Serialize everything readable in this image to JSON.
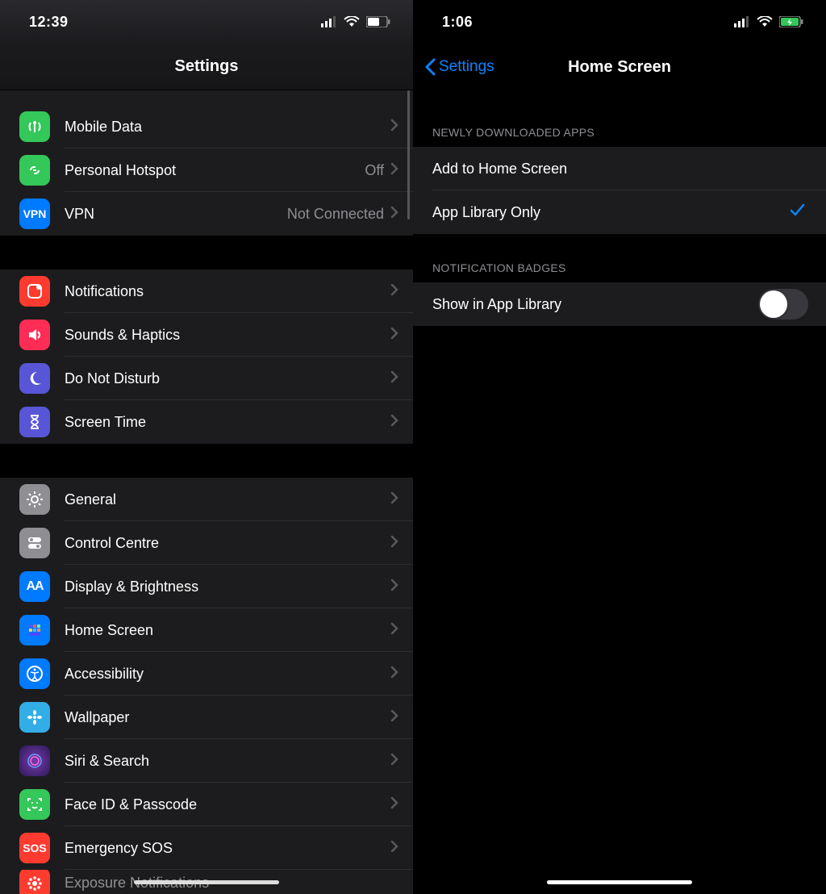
{
  "left": {
    "status_time": "12:39",
    "title": "Settings",
    "group1": [
      {
        "label": "Mobile Data",
        "icon": "cellular-antenna-icon",
        "bg": "bg-green"
      },
      {
        "label": "Personal Hotspot",
        "detail": "Off",
        "icon": "link-icon",
        "bg": "bg-green"
      },
      {
        "label": "VPN",
        "detail": "Not Connected",
        "icon": "vpn-icon",
        "bg": "bg-blue",
        "text_glyph": "VPN"
      }
    ],
    "group2": [
      {
        "label": "Notifications",
        "icon": "notification-icon",
        "bg": "bg-red"
      },
      {
        "label": "Sounds & Haptics",
        "icon": "speaker-icon",
        "bg": "bg-pink"
      },
      {
        "label": "Do Not Disturb",
        "icon": "moon-icon",
        "bg": "bg-purple"
      },
      {
        "label": "Screen Time",
        "icon": "hourglass-icon",
        "bg": "bg-purple"
      }
    ],
    "group3": [
      {
        "label": "General",
        "icon": "gear-icon",
        "bg": "bg-gray"
      },
      {
        "label": "Control Centre",
        "icon": "switches-icon",
        "bg": "bg-gray"
      },
      {
        "label": "Display & Brightness",
        "icon": "text-size-icon",
        "bg": "bg-blue",
        "text_glyph": "AA"
      },
      {
        "label": "Home Screen",
        "icon": "home-grid-icon",
        "bg": "bg-blue"
      },
      {
        "label": "Accessibility",
        "icon": "accessibility-icon",
        "bg": "bg-blue"
      },
      {
        "label": "Wallpaper",
        "icon": "flower-icon",
        "bg": "bg-cyan"
      },
      {
        "label": "Siri & Search",
        "icon": "siri-icon",
        "bg": "bg-night"
      },
      {
        "label": "Face ID & Passcode",
        "icon": "faceid-icon",
        "bg": "bg-faceid"
      },
      {
        "label": "Emergency SOS",
        "icon": "sos-icon",
        "bg": "bg-sos",
        "text_glyph": "SOS"
      },
      {
        "label": "Exposure Notifications",
        "icon": "exposure-icon",
        "bg": "bg-red"
      }
    ]
  },
  "right": {
    "status_time": "1:06",
    "back_label": "Settings",
    "title": "Home Screen",
    "section1_header": "NEWLY DOWNLOADED APPS",
    "section1": [
      {
        "label": "Add to Home Screen",
        "selected": false
      },
      {
        "label": "App Library Only",
        "selected": true
      }
    ],
    "section2_header": "NOTIFICATION BADGES",
    "section2": [
      {
        "label": "Show in App Library",
        "toggled": false
      }
    ]
  }
}
